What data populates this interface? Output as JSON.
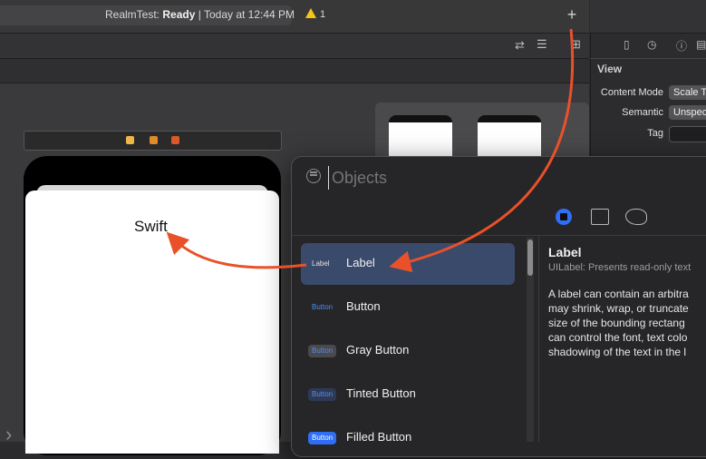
{
  "toolbar": {
    "project": "RealmTest:",
    "status": "Ready",
    "time_text": "| Today at 12:44 PM",
    "warning_count": "1",
    "add_label": "+"
  },
  "canvas": {
    "scene_label_text": "Swift"
  },
  "inspector": {
    "section_title": "View",
    "rows": [
      {
        "label": "Content Mode",
        "value": "Scale T"
      },
      {
        "label": "Semantic",
        "value": "Unspec"
      },
      {
        "label": "Tag",
        "value": ""
      }
    ]
  },
  "objects_library": {
    "search_placeholder": "Objects",
    "items": [
      {
        "badge": "Label",
        "name": "Label",
        "badge_bg": "transparent",
        "badge_color": "#e0e0e0"
      },
      {
        "badge": "Button",
        "name": "Button",
        "badge_bg": "transparent",
        "badge_color": "#4f8cf7"
      },
      {
        "badge": "Button",
        "name": "Gray Button",
        "badge_bg": "#4a4a4c",
        "badge_color": "#4f8cf7"
      },
      {
        "badge": "Button",
        "name": "Tinted Button",
        "badge_bg": "#2e3a55",
        "badge_color": "#4f8cf7"
      },
      {
        "badge": "Button",
        "name": "Filled Button",
        "badge_bg": "#2f6ef5",
        "badge_color": "#ffffff"
      }
    ],
    "detail": {
      "title": "Label",
      "subtitle": "UILabel: Presents read-only text",
      "body": "A label can contain an arbitra\nmay shrink, wrap, or truncate\nsize of the bounding rectang\ncan control the font, text colo\nshadowing of the text in the l"
    }
  },
  "colors": {
    "accent": "#2f6ef5",
    "annotation_arrow": "#e8512a",
    "warning": "#f5c518"
  }
}
